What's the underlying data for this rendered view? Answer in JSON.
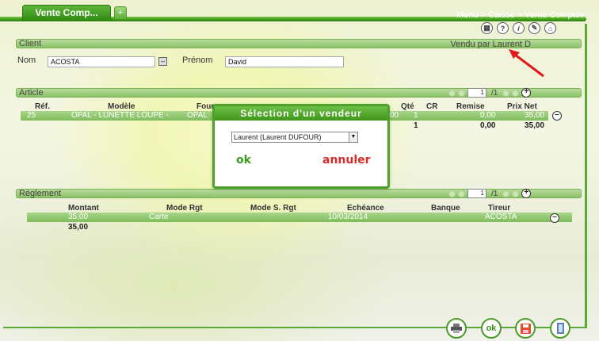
{
  "topbar": {
    "tab_label": "Vente Comp...",
    "add_tab_label": "+",
    "breadcrumb": "Menu > Caisse > Vente Comptoir"
  },
  "client": {
    "section_title": "Client",
    "vendu_par": "Vendu par Laurent D",
    "nom_label": "Nom",
    "nom_value": "ACOSTA",
    "prenom_label": "Prénom",
    "prenom_value": "David"
  },
  "article": {
    "section_title": "Article",
    "pager_page": "1",
    "pager_total": "/1",
    "headers": {
      "ref": "Réf.",
      "modele": "Modèle",
      "four": "Four",
      "qte": "Qté",
      "cr": "CR",
      "remise": "Remise",
      "prix_net": "Prix Net"
    },
    "row": {
      "ref": "25",
      "modele": "OPAL - LUNETTE LOUPE -",
      "four": "OPAL",
      "qte_prefix": "00",
      "qte": "1",
      "remise": "0,00",
      "prix_net": "35,00"
    },
    "totals": {
      "qte": "1",
      "remise": "0,00",
      "prix_net": "35,00"
    }
  },
  "reglement": {
    "section_title": "Règlement",
    "pager_page": "1",
    "pager_total": "/1",
    "headers": {
      "montant": "Montant",
      "mode_rgt": "Mode Rgt",
      "mode_s_rgt": "Mode S. Rgt",
      "echeance": "Echéance",
      "banque": "Banque",
      "tireur": "Tireur"
    },
    "row": {
      "montant": "35,00",
      "mode_rgt": "Carte",
      "echeance": "10/03/2014",
      "tireur": "ACOSTA"
    },
    "total": "35,00"
  },
  "modal": {
    "title": "Sélection d'un vendeur",
    "selected_vendeur": "Laurent (Laurent DUFOUR)",
    "ok_label": "ok",
    "annuler_label": "annuler"
  },
  "footer": {
    "ok_label": "ok"
  },
  "colors": {
    "accent_green": "#3f961a",
    "cancel_red": "#d62b2b",
    "arrow_red": "#e01818"
  },
  "icons": [
    "calculator-icon",
    "help-icon",
    "info-icon",
    "settings-icon",
    "home-icon",
    "printer-icon",
    "save-icon",
    "exit-icon"
  ]
}
